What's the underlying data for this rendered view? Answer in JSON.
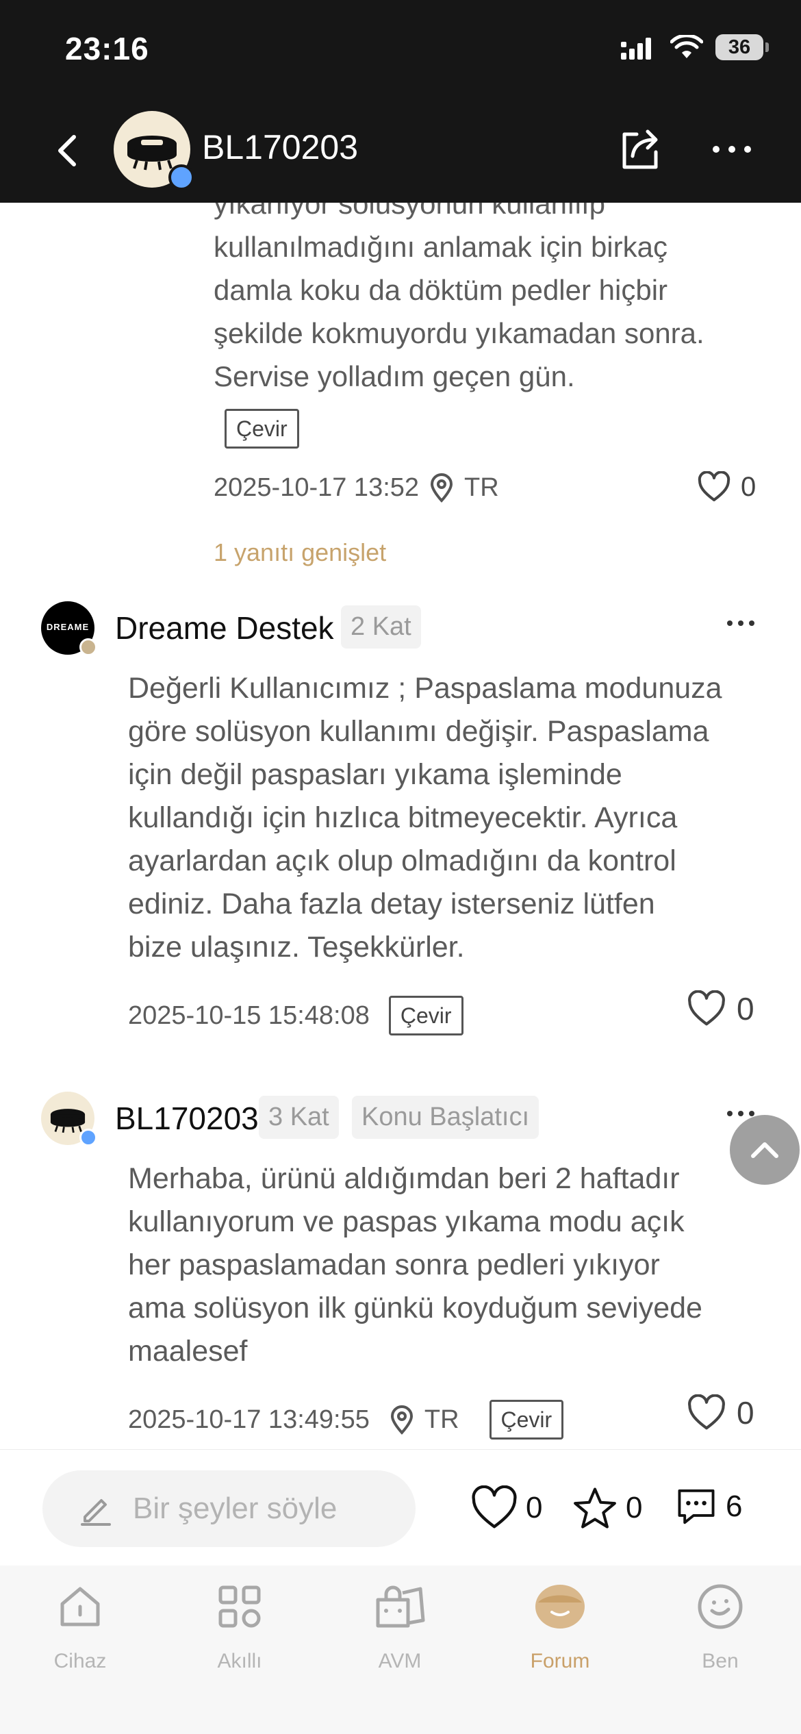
{
  "status_bar": {
    "time": "23:16",
    "battery": "36"
  },
  "header": {
    "username": "BL170203"
  },
  "reply": {
    "lines": [
      "yıkanıyor solüsyonun kullanılıp",
      "kullanılmadığını anlamak için birkaç",
      "damla koku da döktüm pedler hiçbir",
      "şekilde kokmuyordu yıkamadan sonra.",
      "Servise yolladım geçen gün."
    ],
    "translate_label": "Çevir",
    "date": "2025-10-17 13:52",
    "location": "TR",
    "likes": "0",
    "expand_label": "1 yanıtı genişlet"
  },
  "comments": [
    {
      "author": "Dreame Destek",
      "floor": "2 Kat",
      "text_lines": [
        "Değerli Kullanıcımız ; Paspaslama modunuza",
        "göre solüsyon kullanımı değişir. Paspaslama",
        "için değil paspasları yıkama işleminde",
        "kullandığı için hızlıca bitmeyecektir. Ayrıca",
        "ayarlardan açık olup olmadığını da kontrol",
        "ediniz. Daha fazla detay isterseniz lütfen",
        "bize ulaşınız. Teşekkürler."
      ],
      "date": "2025-10-15 15:48:08",
      "translate_label": "Çevir",
      "likes": "0",
      "avatar_text": "DREAME"
    },
    {
      "author": "BL170203",
      "floor": "3 Kat",
      "role": "Konu Başlatıcı",
      "text_lines": [
        "Merhaba, ürünü aldığımdan beri 2 haftadır",
        "kullanıyorum ve paspas yıkama modu açık",
        "her paspaslamadan sonra pedleri yıkıyor",
        "ama solüsyon ilk günkü koyduğum seviyede",
        "maalesef"
      ],
      "date": "2025-10-17 13:49:55",
      "location": "TR",
      "translate_label": "Çevir",
      "likes": "0"
    }
  ],
  "input_bar": {
    "placeholder": "Bir şeyler söyle",
    "likes": "0",
    "favorites": "0",
    "comments": "6"
  },
  "tabs": [
    {
      "label": "Cihaz",
      "icon": "home-icon",
      "active": false
    },
    {
      "label": "Akıllı",
      "icon": "grid-icon",
      "active": false
    },
    {
      "label": "AVM",
      "icon": "shopping-bag-icon",
      "active": false
    },
    {
      "label": "Forum",
      "icon": "forum-icon",
      "active": true
    },
    {
      "label": "Ben",
      "icon": "profile-smile-icon",
      "active": false
    }
  ],
  "colors": {
    "accent": "#c9a069",
    "expand_link": "#c7a36c",
    "header_bg": "#161616"
  }
}
